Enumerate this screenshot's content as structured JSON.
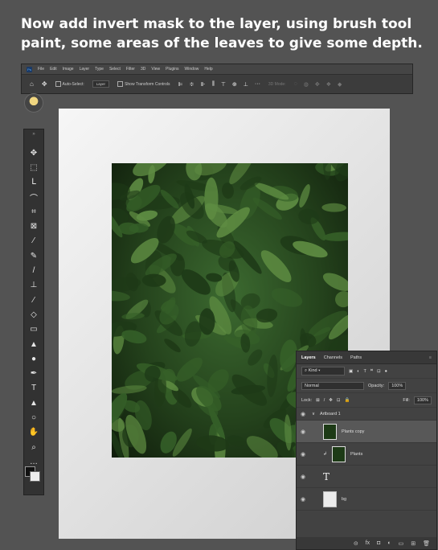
{
  "caption": "Now add invert mask to the layer, using brush tool paint, some areas of the leaves to give some depth.",
  "menu": [
    "File",
    "Edit",
    "Image",
    "Layer",
    "Type",
    "Select",
    "Filter",
    "3D",
    "View",
    "Plugins",
    "Window",
    "Help"
  ],
  "ps_logo": "Ps",
  "options": {
    "auto_select": "Auto-Select:",
    "auto_select_value": "Layer",
    "show_transform": "Show Transform Controls",
    "mode_3d": "3D Mode:"
  },
  "toolbar": {
    "collapse": "»",
    "tools": [
      "move-tool",
      "artboard-tool",
      "lasso-tool",
      "quick-select-tool",
      "crop-tool",
      "frame-tool",
      "eyedropper-tool",
      "healing-tool",
      "brush-tool",
      "clone-stamp-tool",
      "history-brush-tool",
      "eraser-tool",
      "gradient-tool",
      "blur-tool",
      "dodge-tool",
      "pen-tool",
      "type-tool",
      "path-select-tool",
      "ellipse-tool",
      "hand-tool",
      "zoom-tool",
      "more-tools"
    ],
    "glyphs": [
      "✥",
      "⬚",
      "ᒪ",
      "⌒",
      "⌗",
      "⊠",
      "⁄",
      "✎",
      "/",
      "⊥",
      "⁄",
      "◇",
      "▭",
      "▲",
      "●",
      "✒",
      "T",
      "▲",
      "○",
      "✋",
      "⌕",
      "…"
    ]
  },
  "layers": {
    "tabs": [
      "Layers",
      "Channels",
      "Paths"
    ],
    "filter_kind": "Kind",
    "blend_mode": "Normal",
    "opacity_label": "Opacity:",
    "opacity_value": "100%",
    "lock_label": "Lock:",
    "fill_label": "Fill:",
    "fill_value": "100%",
    "items": [
      {
        "name": "Artboard 1",
        "type": "group"
      },
      {
        "name": "Plants copy",
        "type": "image"
      },
      {
        "name": "Plants",
        "type": "image"
      },
      {
        "name": "",
        "type": "text"
      },
      {
        "name": "bg",
        "type": "fill"
      }
    ],
    "footer_icons": [
      "link-icon",
      "fx-icon",
      "mask-icon",
      "adjustment-icon",
      "folder-icon",
      "new-layer-icon",
      "trash-icon"
    ],
    "footer_glyphs": [
      "⊝",
      "fx",
      "◘",
      "◐",
      "▭",
      "⊞",
      "🗑"
    ]
  },
  "colors": {
    "leaf_dark": "#1e3a17",
    "leaf_mid": "#355f28",
    "leaf_light": "#5e8c42"
  }
}
